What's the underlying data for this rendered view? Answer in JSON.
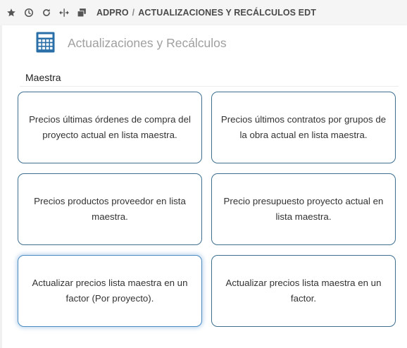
{
  "toolbar": {
    "icons": [
      "star-icon",
      "clock-icon",
      "refresh-icon",
      "split-icon",
      "windows-icon"
    ],
    "breadcrumb": {
      "root": "ADPRO",
      "separator": "/",
      "current": "ACTUALIZACIONES Y RECÁLCULOS EDT"
    }
  },
  "module": {
    "icon": "calculator-icon",
    "title": "Actualizaciones y Recálculos",
    "icon_color": "#2a6fa8"
  },
  "section": {
    "title": "Maestra"
  },
  "cards": [
    {
      "label": "Precios últimas órdenes de compra del proyecto actual en lista maestra."
    },
    {
      "label": "Precios últimos contratos por grupos de la obra actual en lista maestra."
    },
    {
      "label": "Precios productos proveedor en lista maestra."
    },
    {
      "label": "Precio presupuesto proyecto actual en lista maestra."
    },
    {
      "label": "Actualizar precios lista maestra en un factor (Por proyecto)."
    },
    {
      "label": "Actualizar precios lista maestra en un factor."
    }
  ],
  "colors": {
    "card_border": "#3e6f8f",
    "card_active_border": "#4a8cc2",
    "toolbar_bg": "#f5f5f5"
  }
}
